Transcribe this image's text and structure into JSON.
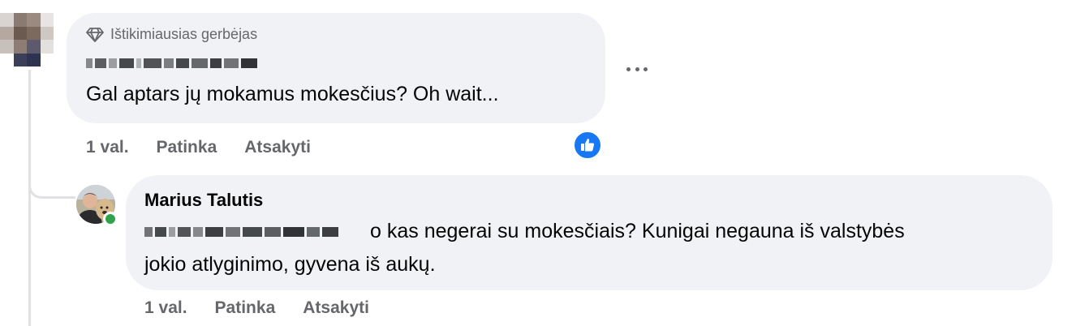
{
  "comment1": {
    "badge_label": "Ištikimiausias gerbėjas",
    "badge_icon": "diamond-icon",
    "text": "Gal aptars jų mokamus mokesčius? Oh wait...",
    "time": "1 val.",
    "like_label": "Patinka",
    "reply_label": "Atsakyti",
    "reaction_icon": "thumbs-up-icon",
    "reaction_color": "#1877f2"
  },
  "comment2": {
    "author": "Marius Talutis",
    "text_line1": "o kas negerai su mokesčiais? Kunigai negauna iš valstybės",
    "text_line2": "jokio atlyginimo, gyvena iš aukų.",
    "time": "1 val.",
    "like_label": "Patinka",
    "reply_label": "Atsakyti",
    "online_color": "#31a24c"
  },
  "colors": {
    "bubble": "#f0f2f5",
    "secondary_text": "#65676b",
    "thread_line": "#dfe1e5"
  }
}
